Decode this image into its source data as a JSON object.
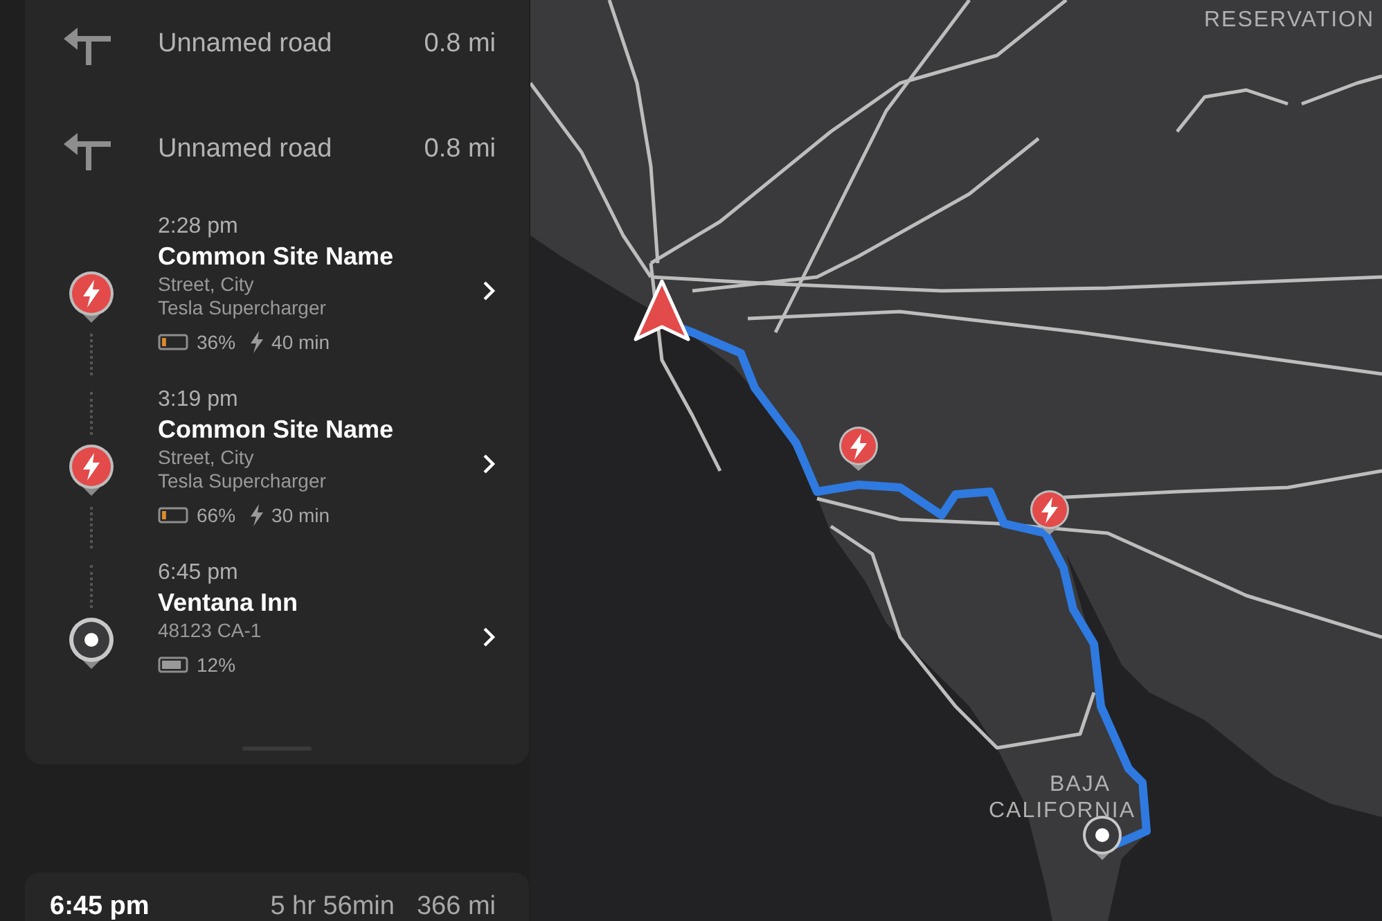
{
  "directions": [
    {
      "road": "Unnamed road",
      "distance": "0.8 mi"
    },
    {
      "road": "Unnamed road",
      "distance": "0.8 mi"
    }
  ],
  "stops": [
    {
      "kind": "charger",
      "time": "2:28 pm",
      "name": "Common Site Name",
      "street": "Street, City",
      "network": "Tesla Supercharger",
      "battery": {
        "level": 0.18,
        "color": "#d98b2b"
      },
      "charge": "36%",
      "charge_time": "40 min"
    },
    {
      "kind": "charger",
      "time": "3:19 pm",
      "name": "Common Site Name",
      "street": "Street, City",
      "network": "Tesla Supercharger",
      "battery": {
        "level": 0.18,
        "color": "#d98b2b"
      },
      "charge": "66%",
      "charge_time": "30 min"
    },
    {
      "kind": "destination",
      "time": "6:45 pm",
      "name": "Ventana Inn",
      "street": "48123 CA-1",
      "battery": {
        "level": 0.85,
        "color": "#9a9a9a"
      },
      "charge": "12%"
    }
  ],
  "summary": {
    "arrival": "6:45 pm",
    "duration": "5 hr 56min",
    "distance": "366 mi"
  },
  "map_labels": [
    "RESERVATION",
    "BAJA",
    "CALIFORNIA"
  ]
}
